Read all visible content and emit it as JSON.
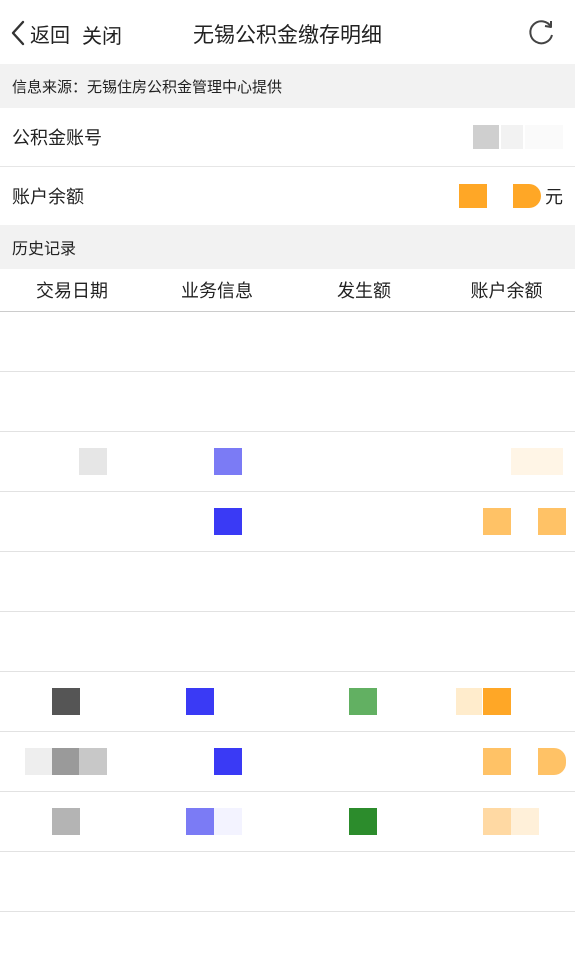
{
  "nav": {
    "back_label": "返回",
    "close_label": "关闭",
    "title": "无锡公积金缴存明细"
  },
  "source": {
    "text": "信息来源：无锡住房公积金管理中心提供"
  },
  "account": {
    "number_label": "公积金账号",
    "balance_label": "账户余额",
    "balance_unit": "元"
  },
  "history": {
    "title": "历史记录",
    "columns": [
      "交易日期",
      "业务信息",
      "发生额",
      "账户余额"
    ],
    "row_count": 10
  },
  "colors": {
    "blue": "#3a3af5",
    "blue_light": "#7b7bf5",
    "green": "#2c8c2c",
    "green_light": "#62b062",
    "orange": "#ffa726",
    "orange_light": "#ffd08a",
    "gray": "#9a9a9a"
  }
}
